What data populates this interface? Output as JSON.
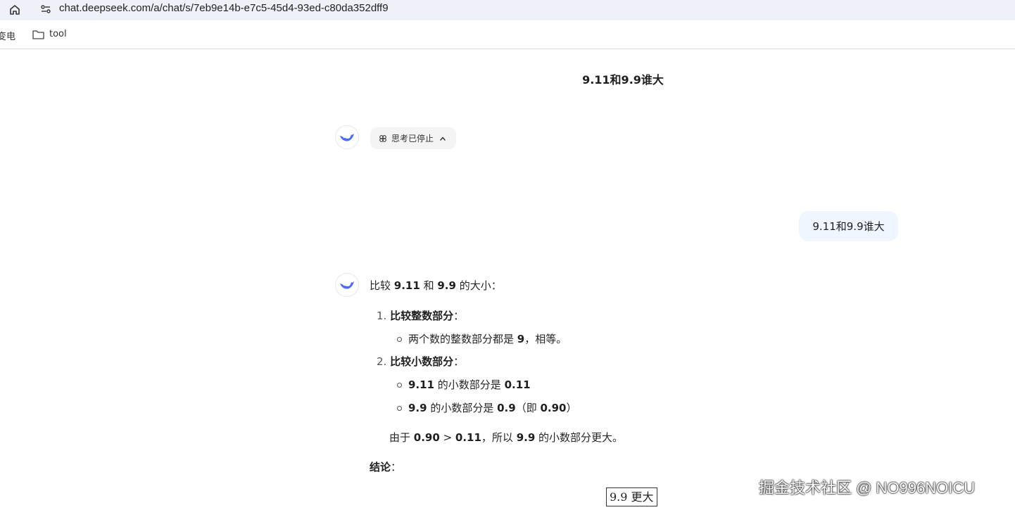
{
  "browser": {
    "url": "chat.deepseek.com/a/chat/s/7eb9e14b-e7c5-45d4-93ed-c80da352dff9",
    "bookmarks": [
      "变电",
      "tool"
    ]
  },
  "chat": {
    "title": "9.11和9.9谁大",
    "thinking_label": "思考已停止",
    "user_message": "9.11和9.9谁大",
    "answer": {
      "lead": {
        "t1": "比较 ",
        "b1": "9.11",
        "t2": " 和 ",
        "b2": "9.9",
        "t3": " 的大小："
      },
      "step1": {
        "num": "1.",
        "title": "比较整数部分",
        "colon": "："
      },
      "step1_bullet": {
        "t1": "两个数的整数部分都是 ",
        "b1": "9",
        "t2": "，相等。"
      },
      "step2": {
        "num": "2.",
        "title": "比较小数部分",
        "colon": "："
      },
      "step2_bullet1": {
        "b1": "9.11",
        "t1": " 的小数部分是 ",
        "b2": "0.11"
      },
      "step2_bullet2": {
        "b1": "9.9",
        "t1": " 的小数部分是 ",
        "b2": "0.9",
        "t2": "（即 ",
        "b3": "0.90",
        "t3": "）"
      },
      "reason": {
        "t1": "由于 ",
        "b1": "0.90",
        "t2": " > ",
        "b2": "0.11",
        "t3": "，所以 ",
        "b3": "9.9",
        "t4": " 的小数部分更大。"
      },
      "conclusion_label": "结论",
      "conclusion_colon": "：",
      "conclusion_value": "9.9 更大"
    }
  },
  "watermark": "掘金技术社区 @ NO996NOICU",
  "colors": {
    "accent": "#4d6bfe",
    "user_bubble": "#eff6ff",
    "address_bar": "#eef1f8"
  }
}
